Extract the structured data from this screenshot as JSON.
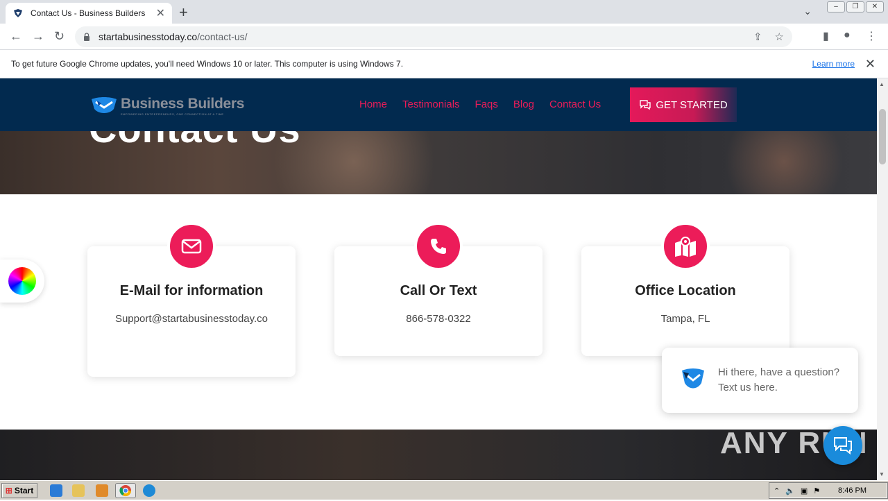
{
  "browser": {
    "tab_title": "Contact Us - Business Builders",
    "url_domain": "startabusinesstoday.co",
    "url_path": "/contact-us/",
    "infobar_text": "To get future Google Chrome updates, you'll need Windows 10 or later. This computer is using Windows 7.",
    "infobar_link": "Learn more"
  },
  "site": {
    "logo_name": "Business Builders",
    "logo_tagline": "EMPOWERING ENTREPRENEURS, ONE CONNECTION AT A TIME",
    "nav": [
      "Home",
      "Testimonials",
      "Faqs",
      "Blog",
      "Contact Us"
    ],
    "cta_label": "GET STARTED",
    "hero_title": "Contact Us",
    "accent_color": "#ec1c59",
    "header_color": "#022a4f"
  },
  "cards": [
    {
      "title": "E-Mail for information",
      "text": "Support@startabusinesstoday.co",
      "icon": "envelope-icon"
    },
    {
      "title": "Call Or Text",
      "text": "866-578-0322",
      "icon": "phone-icon"
    },
    {
      "title": "Office Location",
      "text": "Tampa, FL",
      "icon": "map-pin-icon"
    }
  ],
  "chat": {
    "message": "Hi there, have a question? Text us here."
  },
  "watermark": "ANY RUN",
  "taskbar": {
    "start_label": "Start",
    "clock": "8:46 PM"
  }
}
